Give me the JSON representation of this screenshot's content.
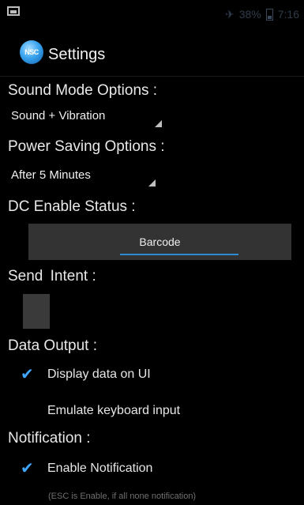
{
  "status_bar": {
    "signal_text": "✈",
    "battery_text": "38%",
    "time": "7:16"
  },
  "action_bar": {
    "icon_text": "NSC",
    "title": "Settings"
  },
  "sound_mode": {
    "label": "Sound Mode Options :",
    "value": "Sound + Vibration"
  },
  "power_saving": {
    "label": "Power Saving Options :",
    "value": "After 5 Minutes"
  },
  "dc_status": {
    "label": "DC Enable Status :",
    "button_label": "Barcode"
  },
  "send_intent": {
    "label_send": "Send",
    "label_intent": "Intent :"
  },
  "data_output": {
    "label": "Data Output :",
    "display_label": "Display data on UI",
    "display_checked": true,
    "emulate_label": "Emulate keyboard input",
    "emulate_checked": false
  },
  "notification": {
    "label": "Notification :",
    "enable_label": "Enable Notification",
    "enable_checked": true,
    "note": "(ESC is Enable, if all none notification)"
  },
  "colors": {
    "accent": "#2d8bd1",
    "check": "#3fa7ff",
    "button_bg": "#333334",
    "background": "#000000"
  }
}
